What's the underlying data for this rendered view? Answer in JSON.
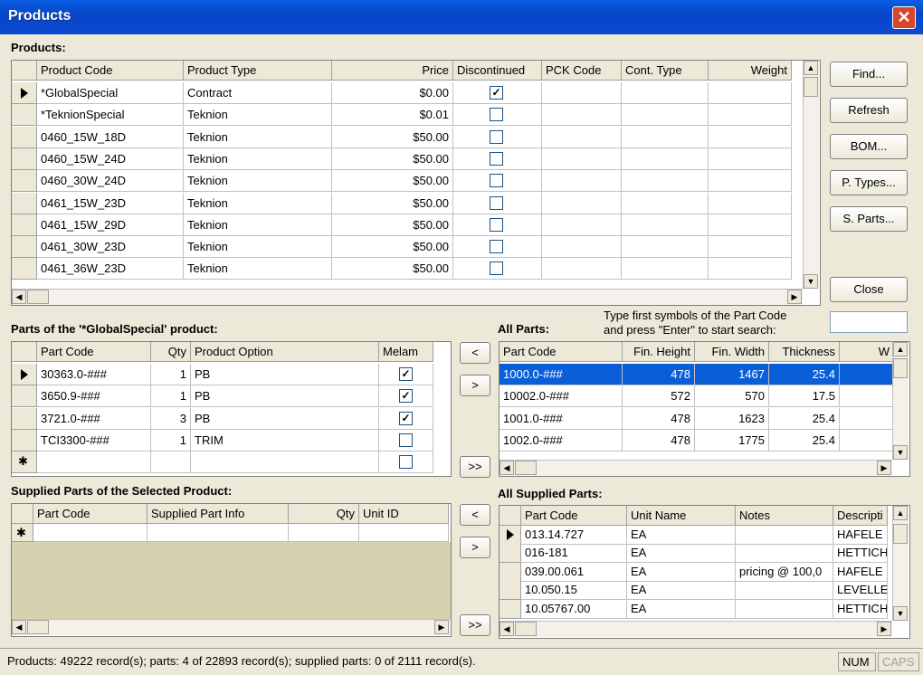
{
  "window": {
    "title": "Products",
    "close": "✕"
  },
  "products": {
    "section": "Products:",
    "columns": [
      "Product Code",
      "Product Type",
      "Price",
      "Discontinued",
      "PCK Code",
      "Cont. Type",
      "Weight"
    ],
    "rows": [
      {
        "code": "*GlobalSpecial",
        "type": "Contract",
        "price": "$0.00",
        "disc": true
      },
      {
        "code": "*TeknionSpecial",
        "type": "Teknion",
        "price": "$0.01",
        "disc": false
      },
      {
        "code": "0460_15W_18D",
        "type": "Teknion",
        "price": "$50.00",
        "disc": false
      },
      {
        "code": "0460_15W_24D",
        "type": "Teknion",
        "price": "$50.00",
        "disc": false
      },
      {
        "code": "0460_30W_24D",
        "type": "Teknion",
        "price": "$50.00",
        "disc": false
      },
      {
        "code": "0461_15W_23D",
        "type": "Teknion",
        "price": "$50.00",
        "disc": false
      },
      {
        "code": "0461_15W_29D",
        "type": "Teknion",
        "price": "$50.00",
        "disc": false
      },
      {
        "code": "0461_30W_23D",
        "type": "Teknion",
        "price": "$50.00",
        "disc": false
      },
      {
        "code": "0461_36W_23D",
        "type": "Teknion",
        "price": "$50.00",
        "disc": false
      }
    ]
  },
  "buttons": {
    "find": "Find...",
    "refresh": "Refresh",
    "bom": "BOM...",
    "ptypes": "P. Types...",
    "sparts": "S. Parts...",
    "close": "Close"
  },
  "parts": {
    "section": "Parts of the '*GlobalSpecial' product:",
    "columns": [
      "Part Code",
      "Qty",
      "Product Option",
      "Melam"
    ],
    "rows": [
      {
        "code": "30363.0-###",
        "qty": "1",
        "opt": "PB",
        "melam": true
      },
      {
        "code": "3650.9-###",
        "qty": "1",
        "opt": "PB",
        "melam": true
      },
      {
        "code": "3721.0-###",
        "qty": "3",
        "opt": "PB",
        "melam": true
      },
      {
        "code": "TCI3300-###",
        "qty": "1",
        "opt": "TRIM",
        "melam": false
      }
    ],
    "new_row_marker": "✱"
  },
  "arrows": {
    "left": "<",
    "right": ">",
    "all": ">>"
  },
  "all_parts": {
    "section": "All Parts:",
    "hint1": "Type first symbols of the Part Code",
    "hint2": "and press \"Enter\" to start search:",
    "search_value": "",
    "columns": [
      "Part Code",
      "Fin. Height",
      "Fin. Width",
      "Thickness",
      "W"
    ],
    "rows": [
      {
        "code": "1000.0-###",
        "h": "478",
        "w": "1467",
        "t": "25.4"
      },
      {
        "code": "10002.0-###",
        "h": "572",
        "w": "570",
        "t": "17.5"
      },
      {
        "code": "1001.0-###",
        "h": "478",
        "w": "1623",
        "t": "25.4"
      },
      {
        "code": "1002.0-###",
        "h": "478",
        "w": "1775",
        "t": "25.4"
      }
    ]
  },
  "supplied": {
    "section": "Supplied Parts of the Selected Product:",
    "columns": [
      "Part Code",
      "Supplied Part Info",
      "Qty",
      "Unit ID"
    ],
    "new_row_marker": "✱"
  },
  "all_supplied": {
    "section": "All Supplied Parts:",
    "columns": [
      "Part Code",
      "Unit Name",
      "Notes",
      "Descripti"
    ],
    "rows": [
      {
        "code": "013.14.727",
        "unit": "EA",
        "notes": "",
        "desc": "HAFELE"
      },
      {
        "code": "016-181",
        "unit": "EA",
        "notes": "",
        "desc": "HETTICH"
      },
      {
        "code": "039.00.061",
        "unit": "EA",
        "notes": "pricing @ 100,0",
        "desc": "HAFELE"
      },
      {
        "code": "10.050.15",
        "unit": "EA",
        "notes": "",
        "desc": "LEVELLEI"
      },
      {
        "code": "10.05767.00",
        "unit": "EA",
        "notes": "",
        "desc": "HETTICH"
      }
    ]
  },
  "status": {
    "text": "Products: 49222 record(s); parts: 4 of 22893 record(s); supplied parts: 0 of 2111 record(s).",
    "num": "NUM",
    "caps": "CAPS"
  }
}
